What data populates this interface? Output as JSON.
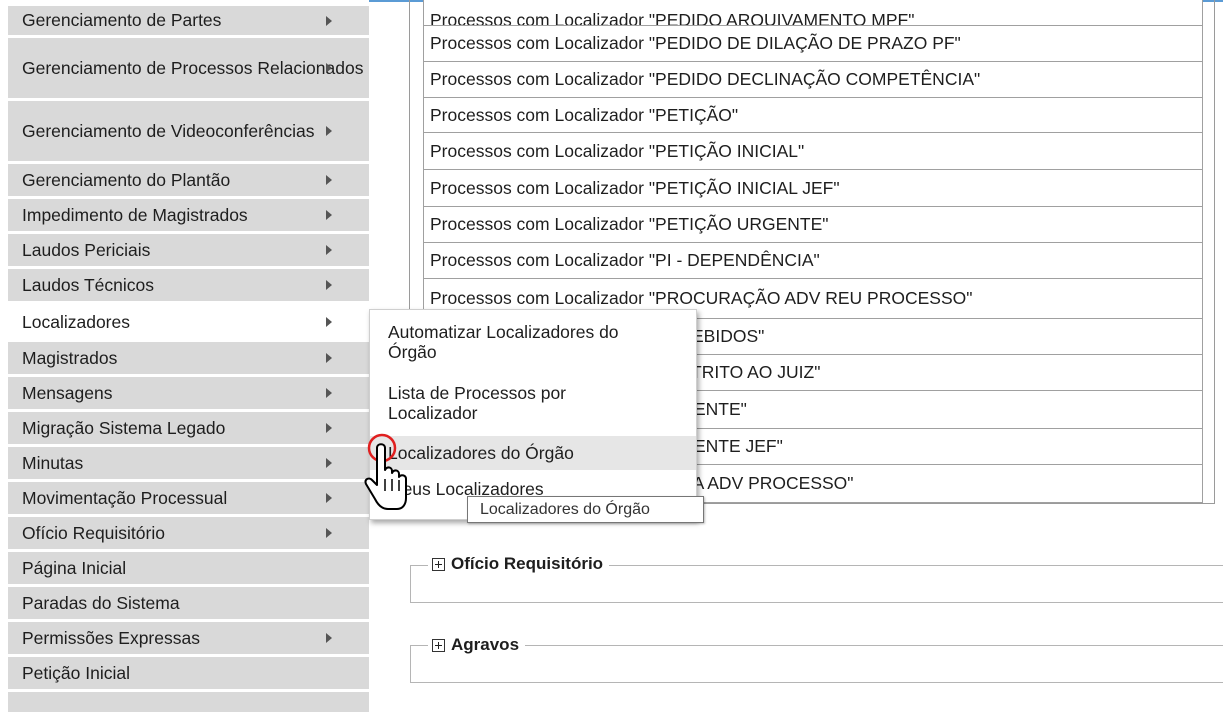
{
  "sidebar": {
    "items": [
      {
        "label": "Gerenciamento de Partes",
        "arrow": true
      },
      {
        "label": "Gerenciamento de Processos Relacionados",
        "arrow": true
      },
      {
        "label": "Gerenciamento de Videoconferências",
        "arrow": true
      },
      {
        "label": "Gerenciamento do Plantão",
        "arrow": true
      },
      {
        "label": "Impedimento de Magistrados",
        "arrow": true
      },
      {
        "label": "Laudos Periciais",
        "arrow": true
      },
      {
        "label": "Laudos Técnicos",
        "arrow": true
      },
      {
        "label": "Localizadores",
        "arrow": true
      },
      {
        "label": "Magistrados",
        "arrow": true
      },
      {
        "label": "Mensagens",
        "arrow": true
      },
      {
        "label": "Migração Sistema Legado",
        "arrow": true
      },
      {
        "label": "Minutas",
        "arrow": true
      },
      {
        "label": "Movimentação Processual",
        "arrow": true
      },
      {
        "label": "Ofício Requisitório",
        "arrow": true
      },
      {
        "label": "Página Inicial",
        "arrow": false
      },
      {
        "label": "Paradas do Sistema",
        "arrow": false
      },
      {
        "label": "Permissões Expressas",
        "arrow": true
      },
      {
        "label": "Petição Inicial",
        "arrow": false
      }
    ]
  },
  "process_list": {
    "rows": [
      "Processos com Localizador  \"PEDIDO ARQUIVAMENTO MPF\"",
      "Processos com Localizador  \"PEDIDO DE DILAÇÃO DE PRAZO PF\"",
      "Processos com Localizador  \"PEDIDO DECLINAÇÃO COMPETÊNCIA\"",
      "Processos com Localizador  \"PETIÇÃO\"",
      "Processos com Localizador  \"PETIÇÃO INICIAL\"",
      "Processos com Localizador  \"PETIÇÃO INICIAL JEF\"",
      "Processos com Localizador  \"PETIÇÃO URGENTE\"",
      "Processos com Localizador  \"PI - DEPENDÊNCIA\"",
      "Processos com Localizador  \"PROCURAÇÃO ADV REU PROCESSO\"",
      "Processos com Localizador  \"RECEBIDOS\"",
      "Processos com Localizador  \"RESTRITO AO JUIZ\"",
      "Processos com Localizador  \"URGENTE\"",
      "Processos com Localizador  \"URGENTE JEF\"",
      "Processos com Localizador  \"VISTA ADV PROCESSO\""
    ]
  },
  "sections": {
    "oficio": "Ofício Requisitório",
    "agravos": "Agravos"
  },
  "submenu": {
    "items": [
      "Automatizar Localizadores do Órgão",
      "Lista de Processos por Localizador",
      "Localizadores do Órgão",
      "Meus Localizadores"
    ]
  },
  "tooltip": "Localizadores do Órgão",
  "colors": {
    "sidebar_bg": "#d9d9d9",
    "topline": "#5b9bd5",
    "cursor_ring": "#e02020"
  }
}
